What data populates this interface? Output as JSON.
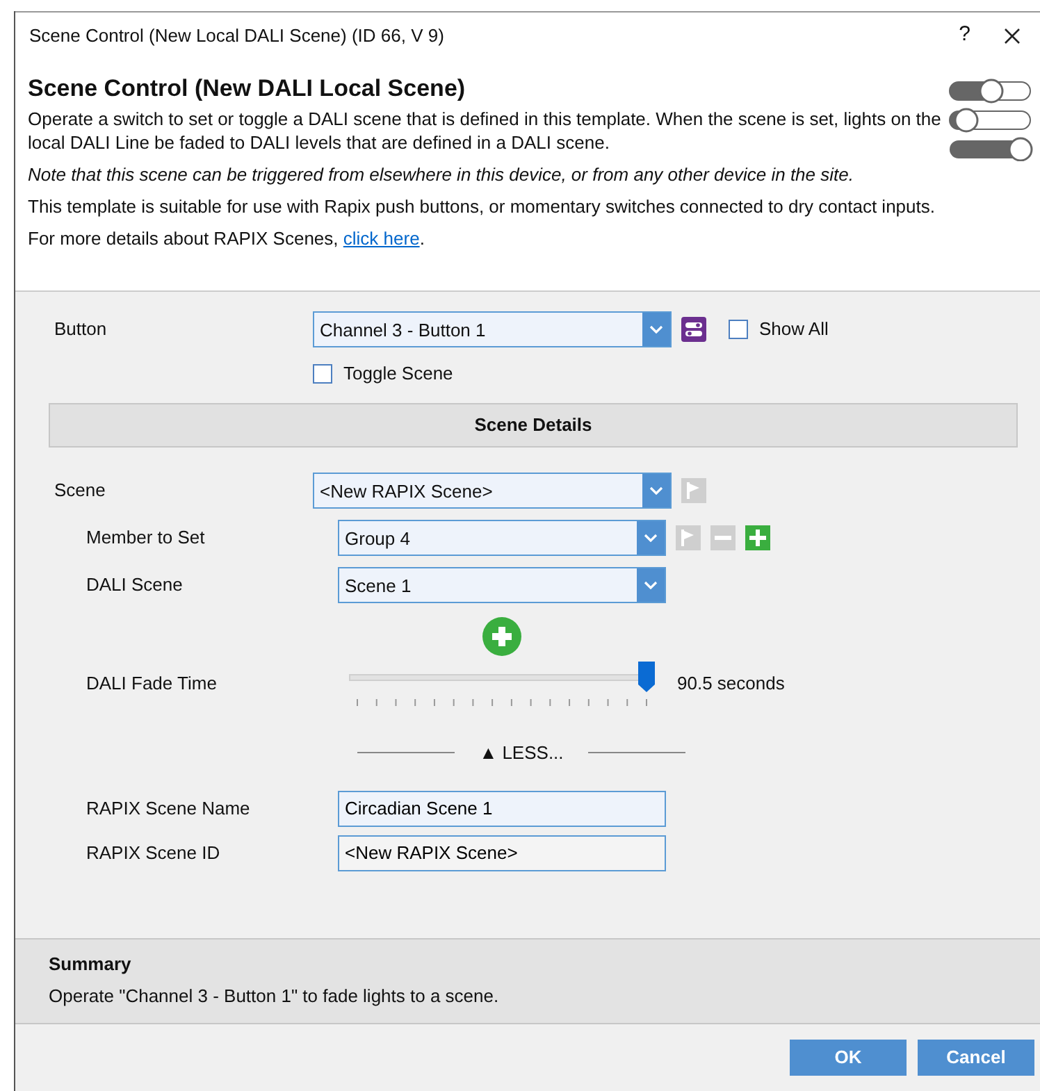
{
  "window": {
    "title": "Scene Control (New Local DALI Scene) (ID 66, V 9)",
    "help": "?"
  },
  "header": {
    "title": "Scene Control (New DALI Local Scene)",
    "paragraphs": [
      {
        "kind": "normal",
        "text": "Operate a switch to set or toggle a DALI scene that is defined in this template. When the scene is set, lights on the local DALI Line be faded to DALI levels that are defined in a DALI scene."
      },
      {
        "kind": "italic",
        "text": "Note that this scene can be triggered from elsewhere in this device, or from any other device in the site."
      },
      {
        "kind": "normal",
        "text": "This template is suitable for use with Rapix push buttons, or momentary switches connected to dry contact inputs."
      },
      {
        "kind": "link",
        "text": "For more details about RAPIX Scenes, ",
        "link": "click here",
        "after": "."
      }
    ]
  },
  "button_row": {
    "label": "Button",
    "value": "Channel 3 - Button 1",
    "show_all": {
      "label": "Show All",
      "checked": false
    }
  },
  "toggle_scene": {
    "label": "Toggle Scene",
    "checked": false
  },
  "section_header": "Scene Details",
  "scene": {
    "label": "Scene",
    "value": "<New RAPIX Scene>"
  },
  "member": {
    "label": "Member to Set",
    "value": "Group 4"
  },
  "dali_scene": {
    "label": "DALI Scene",
    "value": "Scene 1"
  },
  "fade_time": {
    "label": "DALI Fade Time",
    "level": 1,
    "reading": "90.5 seconds"
  },
  "less_toggle": "▲ LESS...",
  "scene_name": {
    "label": "RAPIX Scene Name",
    "value": "Circadian Scene 1"
  },
  "scene_id": {
    "label": "RAPIX Scene ID",
    "value": "<New RAPIX Scene>"
  },
  "summary": {
    "title": "Summary",
    "text": "Operate \"Channel 3 - Button 1\" to fade lights to a scene."
  },
  "buttons": [
    "OK",
    "Cancel"
  ]
}
